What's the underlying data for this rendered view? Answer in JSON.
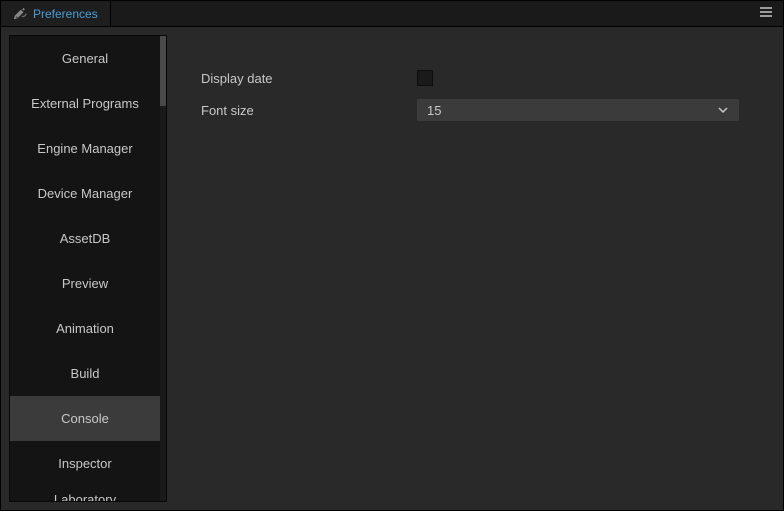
{
  "tab": {
    "label": "Preferences"
  },
  "sidebar": {
    "items": [
      {
        "label": "General",
        "active": false
      },
      {
        "label": "External Programs",
        "active": false
      },
      {
        "label": "Engine Manager",
        "active": false
      },
      {
        "label": "Device Manager",
        "active": false
      },
      {
        "label": "AssetDB",
        "active": false
      },
      {
        "label": "Preview",
        "active": false
      },
      {
        "label": "Animation",
        "active": false
      },
      {
        "label": "Build",
        "active": false
      },
      {
        "label": "Console",
        "active": true
      },
      {
        "label": "Inspector",
        "active": false
      },
      {
        "label": "Laboratory",
        "active": false
      }
    ]
  },
  "settings": {
    "display_date_label": "Display date",
    "display_date_checked": false,
    "font_size_label": "Font size",
    "font_size_value": "15"
  }
}
